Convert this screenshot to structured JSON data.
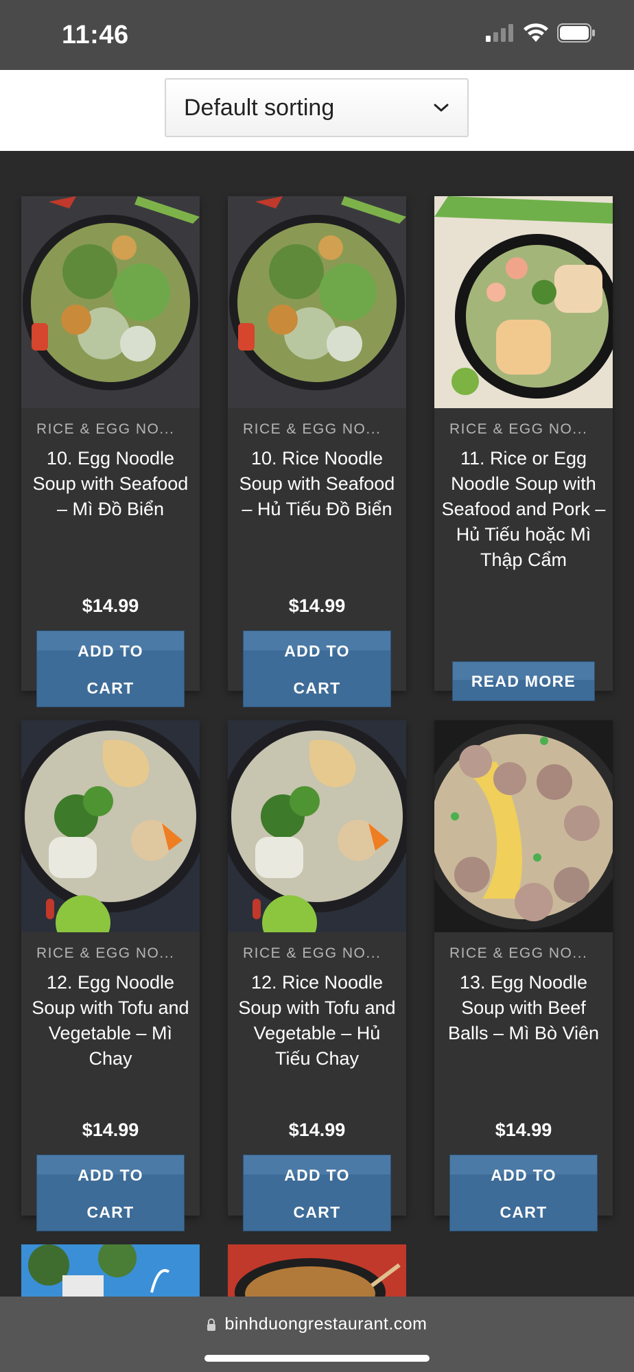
{
  "status_bar": {
    "time": "11:46"
  },
  "sorting": {
    "selected": "Default sorting"
  },
  "products": [
    {
      "category": "RICE & EGG NO...",
      "title": "10. Egg Noodle Soup with Seafood – Mì Đồ Biển",
      "price": "$14.99",
      "button": [
        "ADD TO",
        "CART"
      ]
    },
    {
      "category": "RICE & EGG NO...",
      "title": "10. Rice Noodle Soup with Seafood – Hủ Tiếu Đồ Biển",
      "price": "$14.99",
      "button": [
        "ADD TO",
        "CART"
      ]
    },
    {
      "category": "RICE & EGG NO...",
      "title": "11. Rice or Egg Noodle Soup with Seafood and Pork – Hủ Tiếu hoặc Mì Thập Cẩm",
      "button": [
        "READ MORE"
      ]
    },
    {
      "category": "RICE & EGG NO...",
      "title": "12. Egg Noodle Soup with Tofu and Vegetable – Mì Chay",
      "price": "$14.99",
      "button": [
        "ADD TO",
        "CART"
      ]
    },
    {
      "category": "RICE & EGG NO...",
      "title": "12. Rice Noodle Soup with Tofu and Vegetable – Hủ Tiếu Chay",
      "price": "$14.99",
      "button": [
        "ADD TO",
        "CART"
      ]
    },
    {
      "category": "RICE & EGG NO...",
      "title": "13. Egg Noodle Soup with Beef Balls – Mì Bò Viên",
      "price": "$14.99",
      "button": [
        "ADD TO",
        "CART"
      ]
    }
  ],
  "browser": {
    "url": "binhduongrestaurant.com"
  },
  "colors": {
    "page_bg": "#2a2a2a",
    "card_bg": "#333333",
    "button_blue": "#3e6c98",
    "status_bar": "#4a4a4a",
    "url_bar": "#565656"
  },
  "icons": [
    "signal-icon",
    "wifi-icon",
    "battery-icon",
    "chevron-down-icon",
    "lock-icon"
  ]
}
